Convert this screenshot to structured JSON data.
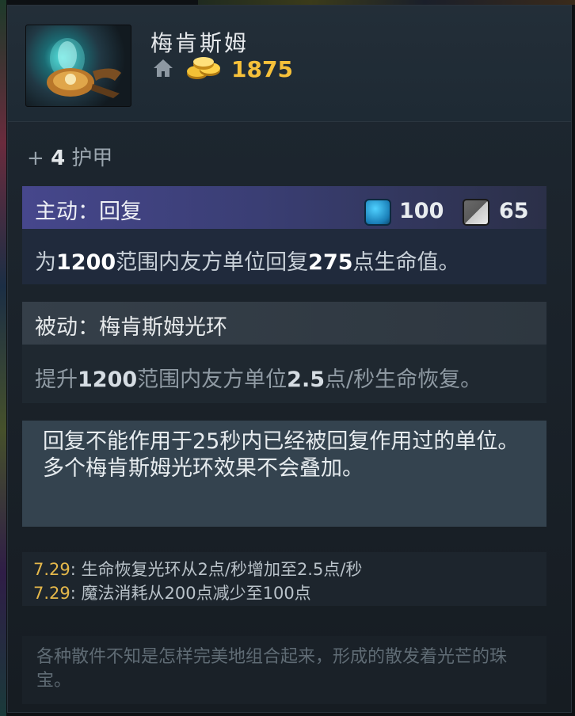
{
  "item": {
    "name": "梅肯斯姆",
    "cost": "1875"
  },
  "stat": {
    "prefix": "+",
    "value": "4",
    "label": "护甲"
  },
  "active": {
    "title": "主动：回复",
    "mana_cost": "100",
    "cooldown": "65",
    "desc_a": "为",
    "desc_b": "1200",
    "desc_c": "范围内友方单位回复",
    "desc_d": "275",
    "desc_e": "点生命值。"
  },
  "passive": {
    "title": "被动：梅肯斯姆光环",
    "desc_a": "提升",
    "desc_b": "1200",
    "desc_c": "范围内友方单位",
    "desc_d": "2.5",
    "desc_e": "点/秒生命恢复。"
  },
  "note": {
    "line1": "回复不能作用于25秒内已经被回复作用过的单位。",
    "line2": "多个梅肯斯姆光环效果不会叠加。"
  },
  "changes": [
    {
      "version": "7.29",
      "text": ": 生命恢复光环从2点/秒增加至2.5点/秒"
    },
    {
      "version": "7.29",
      "text": ": 魔法消耗从200点减少至100点"
    }
  ],
  "lore": "各种散件不知是怎样完美地组合起来，形成的散发着光芒的珠宝。",
  "icons": {
    "item": "mekansm-item-icon",
    "shop": "home-icon",
    "gold": "gold-coins-icon",
    "mana": "mana-icon",
    "cooldown": "cooldown-icon"
  },
  "colors": {
    "gold": "#f6c13a",
    "active_header": "#46478c",
    "version": "#e5b84b"
  }
}
